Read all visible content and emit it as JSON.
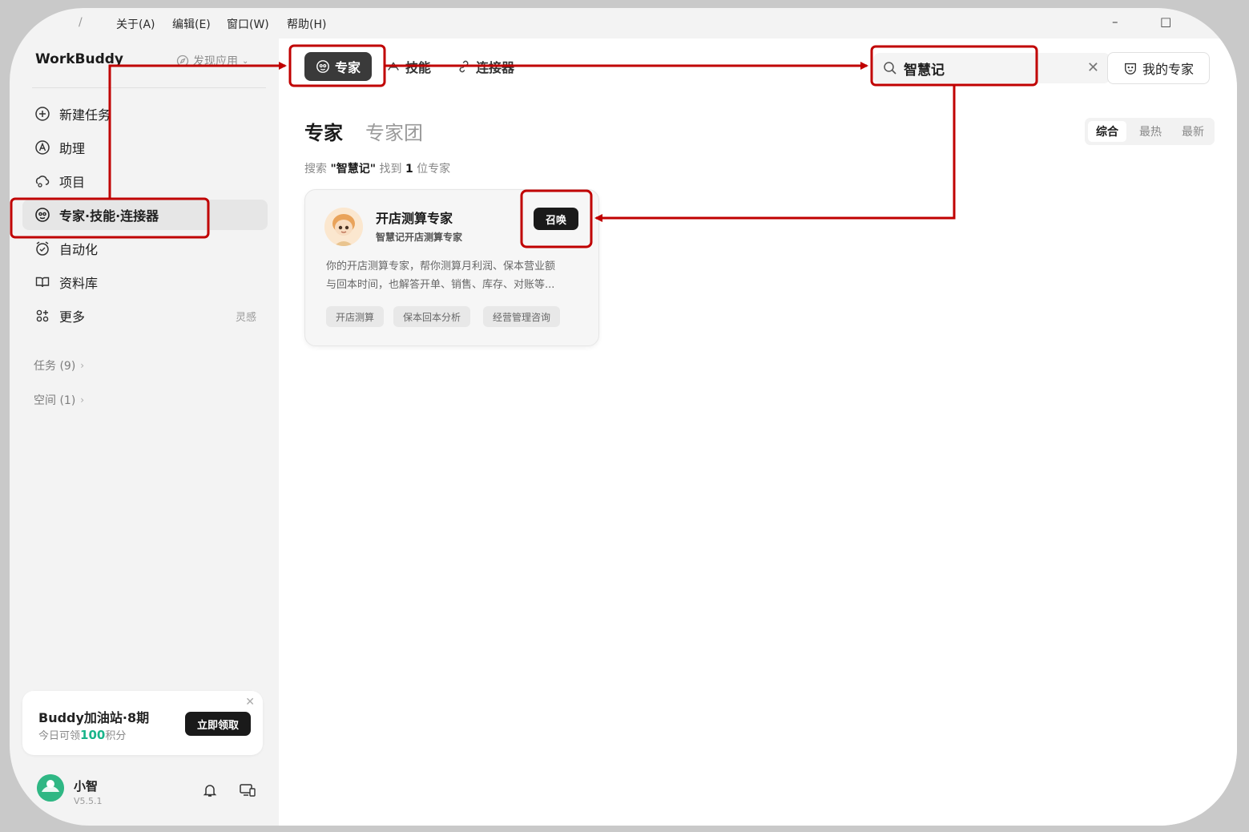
{
  "menubar": {
    "items": [
      "关于(A)",
      "编辑(E)",
      "窗口(W)",
      "帮助(H)"
    ],
    "minimize": "–",
    "maximize": "□"
  },
  "sidebar": {
    "brand": "WorkBuddy",
    "discover": "发现应用",
    "items": [
      {
        "label": "新建任务",
        "icon": "plus-circle-icon"
      },
      {
        "label": "助理",
        "icon": "assistant-icon"
      },
      {
        "label": "项目",
        "icon": "project-icon"
      },
      {
        "label": "专家·技能·连接器",
        "icon": "expert-icon"
      },
      {
        "label": "自动化",
        "icon": "alarm-icon"
      },
      {
        "label": "资料库",
        "icon": "book-icon"
      },
      {
        "label": "更多",
        "icon": "apps-icon",
        "extra": "灵感"
      }
    ],
    "sections": [
      {
        "label": "任务 (9)"
      },
      {
        "label": "空间 (1)"
      }
    ],
    "promo": {
      "title": "Buddy加油站·8期",
      "sub_prefix": "今日可领",
      "sub_points": "100",
      "sub_suffix": "积分",
      "button": "立即领取"
    },
    "user": {
      "name": "小智",
      "version": "V5.5.1"
    }
  },
  "header": {
    "tabs": [
      "专家",
      "技能",
      "连接器"
    ],
    "search_value": "智慧记",
    "my_expert": "我的专家"
  },
  "page": {
    "tabs": [
      "专家",
      "专家团"
    ],
    "sort": [
      "综合",
      "最热",
      "最新"
    ],
    "result": {
      "prefix": "搜索 ",
      "keyword": "\"智慧记\"",
      "middle": " 找到 ",
      "count": "1",
      "suffix": " 位专家"
    }
  },
  "card": {
    "title": "开店测算专家",
    "subtitle": "智慧记开店测算专家",
    "summon": "召唤",
    "desc_line1": "你的开店测算专家，帮你测算月利润、保本营业额",
    "desc_line2": "与回本时间，也解答开单、销售、库存、对账等...",
    "tags": [
      "开店测算",
      "保本回本分析",
      "经营管理咨询"
    ]
  },
  "colors": {
    "annotation": "#c00000",
    "accent_green": "#19b48a",
    "dark_button": "#1a1a1a"
  }
}
